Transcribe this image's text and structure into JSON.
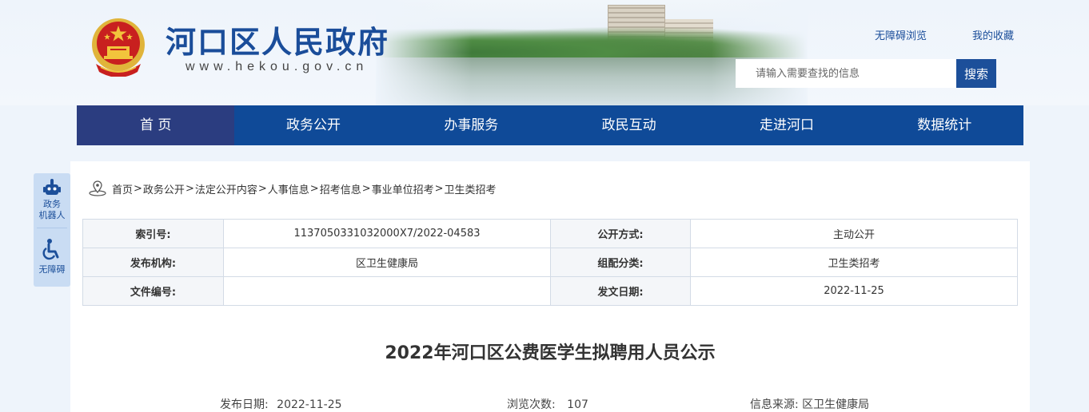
{
  "header": {
    "site_title": "河口区人民政府",
    "site_url": "www.hekou.gov.cn",
    "accessibility_link": "无障碍浏览",
    "favorites_link": "我的收藏",
    "search_placeholder": "请输入需要查找的信息",
    "search_button": "搜索",
    "emblem_icon": "national-emblem-icon"
  },
  "nav": {
    "items": [
      {
        "label": "首 页",
        "active": true
      },
      {
        "label": "政务公开",
        "active": false
      },
      {
        "label": "办事服务",
        "active": false
      },
      {
        "label": "政民互动",
        "active": false
      },
      {
        "label": "走进河口",
        "active": false
      },
      {
        "label": "数据统计",
        "active": false
      }
    ]
  },
  "sidebar": {
    "robot_label_1": "政务",
    "robot_label_2": "机器人",
    "accessibility_label": "无障碍",
    "robot_icon": "robot-icon",
    "accessibility_icon": "wheelchair-icon"
  },
  "breadcrumb": {
    "icon": "location-pin-icon",
    "items": [
      "首页",
      "政务公开",
      "法定公开内容",
      "人事信息",
      "招考信息",
      "事业单位招考",
      "卫生类招考"
    ],
    "separator": ">"
  },
  "meta": {
    "index_label": "索引号:",
    "index_value": "1137050331032000X7/2022-04583",
    "open_mode_label": "公开方式:",
    "open_mode_value": "主动公开",
    "publisher_label": "发布机构:",
    "publisher_value": "区卫生健康局",
    "category_label": "组配分类:",
    "category_value": "卫生类招考",
    "doc_no_label": "文件编号:",
    "doc_no_value": "",
    "issue_date_label": "发文日期:",
    "issue_date_value": "2022-11-25"
  },
  "article": {
    "title": "2022年河口区公费医学生拟聘用人员公示",
    "publish_date_label": "发布日期:",
    "publish_date_value": "2022-11-25",
    "views_label": "浏览次数:",
    "views_value": "107",
    "source_label": "信息来源:",
    "source_value": "区卫生健康局"
  },
  "colors": {
    "nav_bg": "#0f4a98",
    "nav_active": "#2b3d80",
    "title_blue": "#1a4d9a",
    "page_bg": "#eef4fb"
  }
}
